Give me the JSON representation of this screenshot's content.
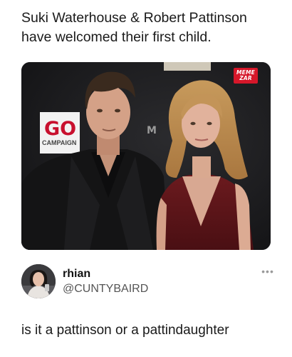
{
  "headline": {
    "line1": "Suki Waterhouse & Robert Pattinson",
    "line2": "have welcomed their first child."
  },
  "photo": {
    "backdrop_sign_text": "GO",
    "backdrop_sign_subtext": "CAMPAIGN",
    "backdrop_letter": "M",
    "watermark_line1": "MEME",
    "watermark_line2": "ZAR",
    "colors": {
      "backdrop": "#1b1b1d",
      "watermark": "#d6172a",
      "sign_red": "#c8102e"
    }
  },
  "tweet": {
    "display_name": "rhian",
    "handle": "@CUNTYBAIRD",
    "more_icon": "•••",
    "text": "is it a pattinson or a pattindaughter"
  }
}
